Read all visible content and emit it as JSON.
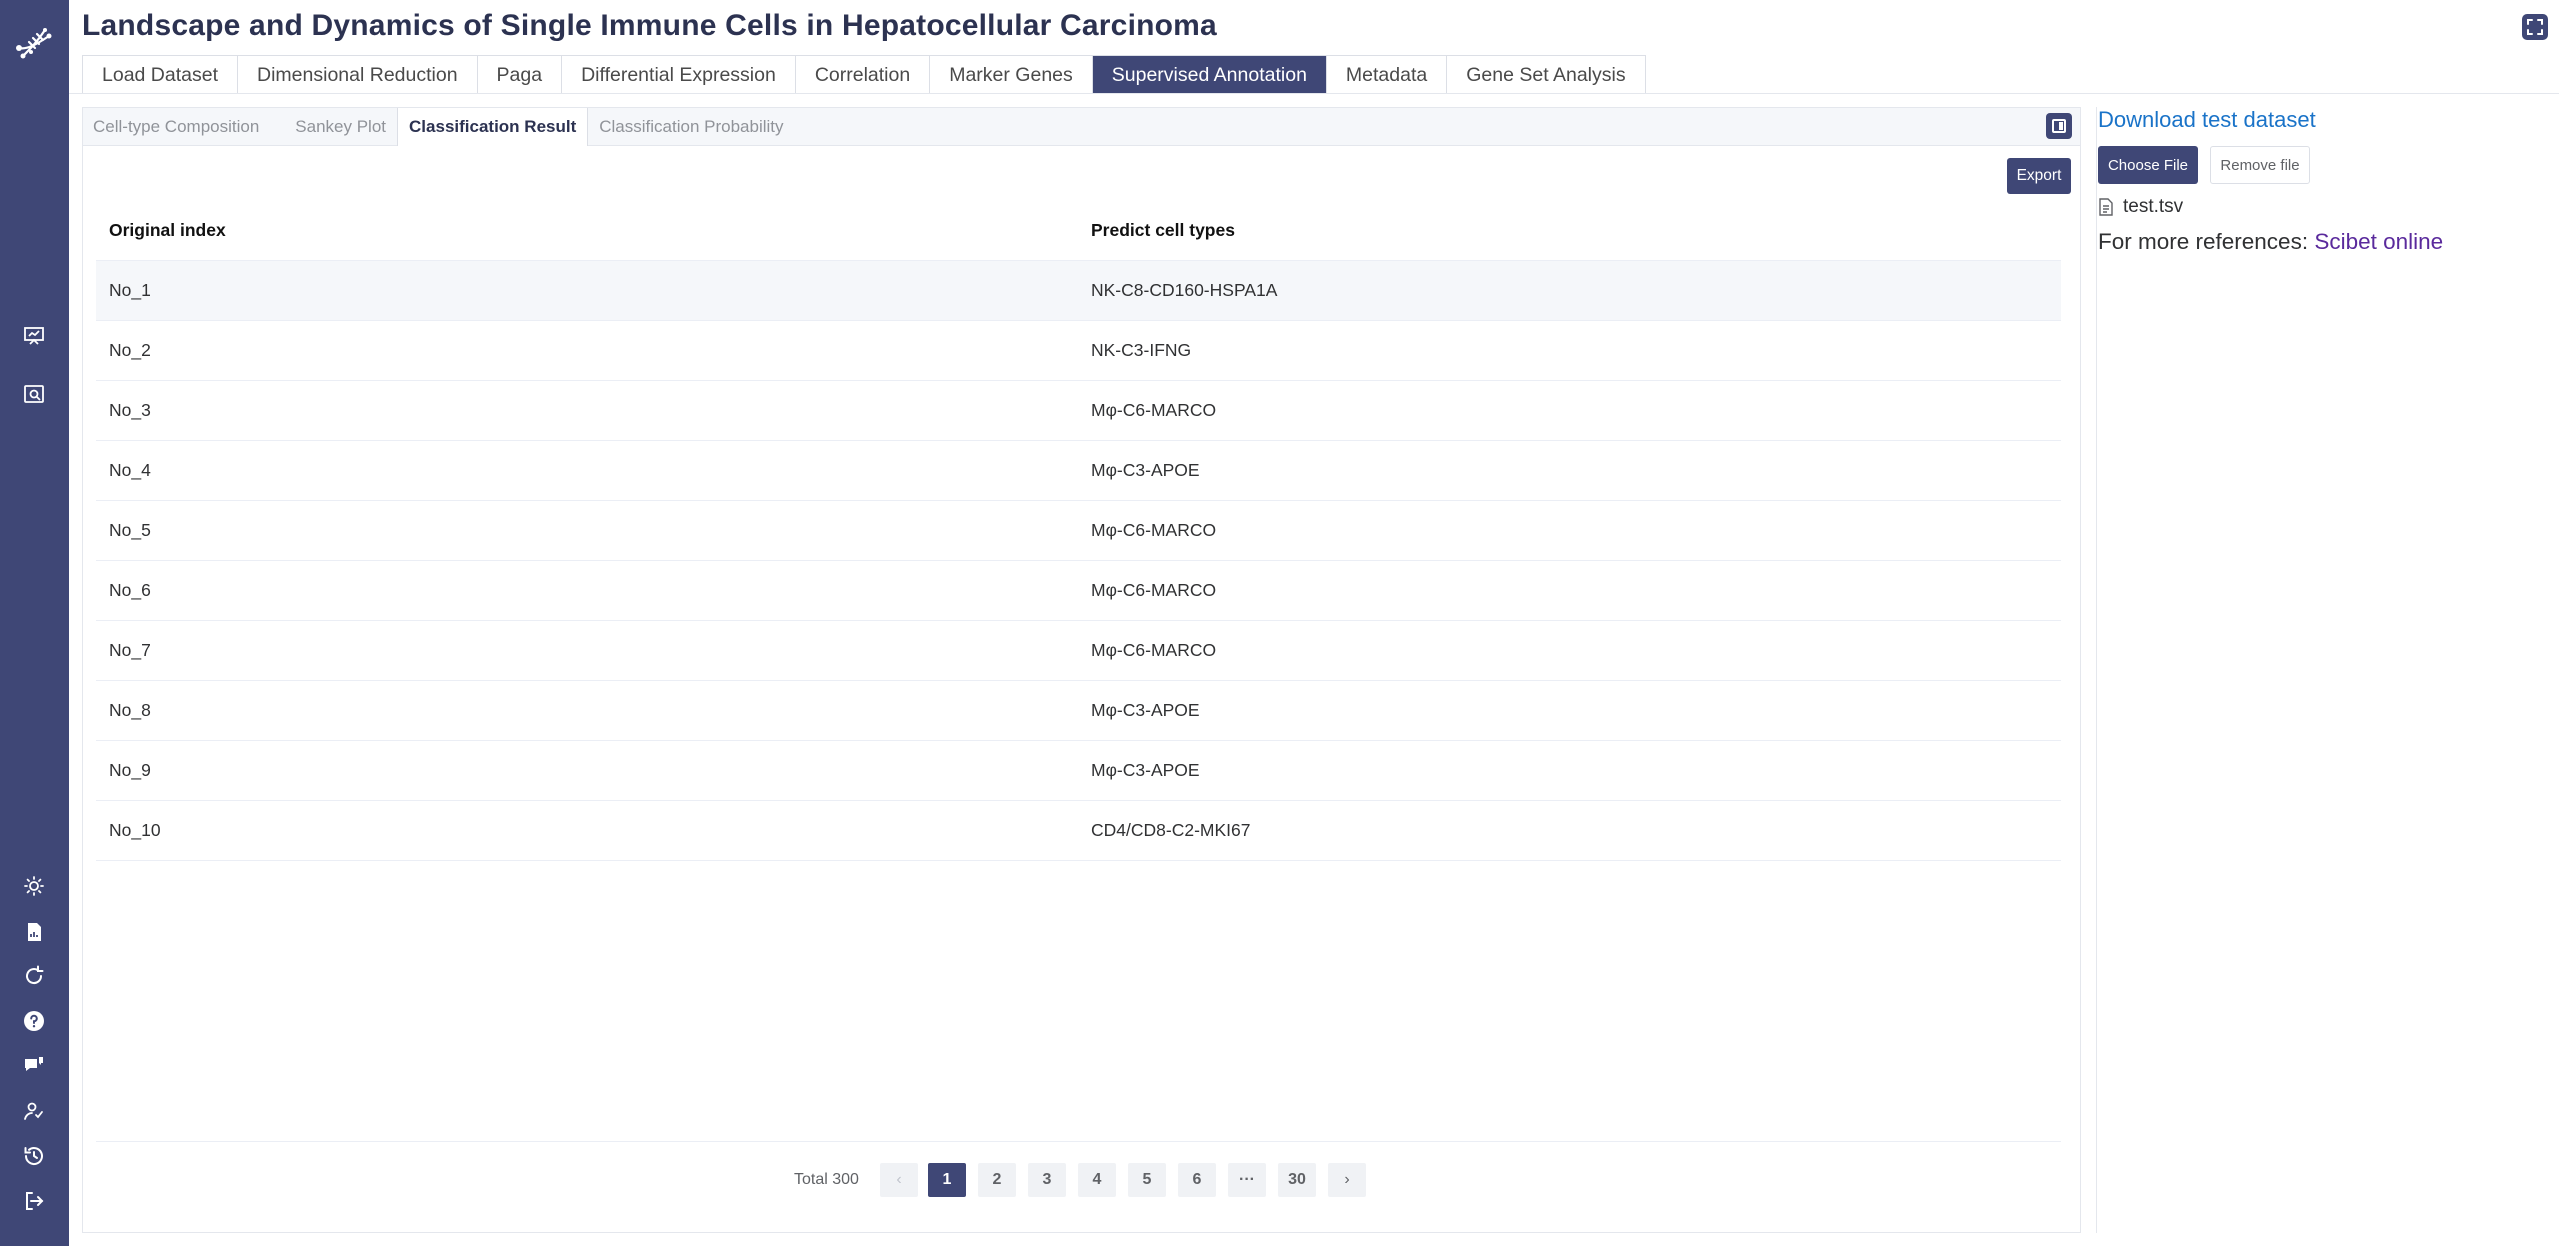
{
  "app": {
    "title": "Landscape and Dynamics of Single Immune Cells in Hepatocellular Carcinoma"
  },
  "sidebar": {
    "logo_icon": "dna-logo-icon",
    "icons": [
      "presentation-icon",
      "search-document-icon",
      "sun-icon",
      "file-report-icon",
      "refresh-icon",
      "help-icon",
      "chat-icon",
      "user-feedback-icon",
      "history-icon",
      "logout-icon"
    ]
  },
  "top_tabs": [
    {
      "label": "Load Dataset",
      "active": false
    },
    {
      "label": "Dimensional Reduction",
      "active": false
    },
    {
      "label": "Paga",
      "active": false
    },
    {
      "label": "Differential Expression",
      "active": false
    },
    {
      "label": "Correlation",
      "active": false
    },
    {
      "label": "Marker Genes",
      "active": false
    },
    {
      "label": "Supervised Annotation",
      "active": true
    },
    {
      "label": "Metadata",
      "active": false
    },
    {
      "label": "Gene Set Analysis",
      "active": false
    }
  ],
  "sub_tabs": [
    {
      "label": "Cell-type Composition",
      "active": false
    },
    {
      "label": "Sankey Plot",
      "active": false
    },
    {
      "label": "Classification Result",
      "active": true
    },
    {
      "label": "Classification Probability",
      "active": false
    }
  ],
  "toolbar": {
    "export_label": "Export"
  },
  "table": {
    "columns": [
      "Original index",
      "Predict cell types"
    ],
    "rows": [
      [
        "No_1",
        "NK-C8-CD160-HSPA1A"
      ],
      [
        "No_2",
        "NK-C3-IFNG"
      ],
      [
        "No_3",
        "Mφ-C6-MARCO"
      ],
      [
        "No_4",
        "Mφ-C3-APOE"
      ],
      [
        "No_5",
        "Mφ-C6-MARCO"
      ],
      [
        "No_6",
        "Mφ-C6-MARCO"
      ],
      [
        "No_7",
        "Mφ-C6-MARCO"
      ],
      [
        "No_8",
        "Mφ-C3-APOE"
      ],
      [
        "No_9",
        "Mφ-C3-APOE"
      ],
      [
        "No_10",
        "CD4/CD8-C2-MKI67"
      ]
    ]
  },
  "pagination": {
    "total_label": "Total 300",
    "prev": "‹",
    "next": "›",
    "pages": [
      "1",
      "2",
      "3",
      "4",
      "5",
      "6",
      "···",
      "30"
    ],
    "current": "1"
  },
  "right_panel": {
    "download_link": "Download test dataset",
    "choose_file": "Choose File",
    "remove_file": "Remove file",
    "file_name": "test.tsv",
    "refs_prefix": "For more references: ",
    "refs_link": "Scibet online"
  },
  "colors": {
    "sidebar_bg": "#3f4776",
    "accent": "#3f4776",
    "link": "#1a73c8",
    "visited_link": "#5a2a9c"
  }
}
